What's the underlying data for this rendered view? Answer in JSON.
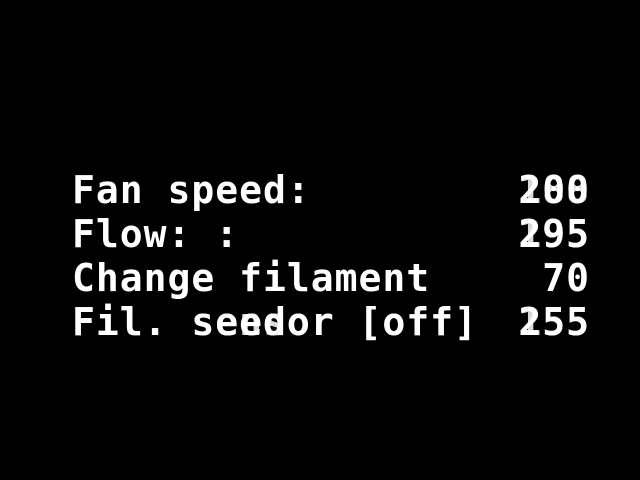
{
  "menu": {
    "rows": [
      {
        "label": "Fan speed:",
        "value": "200",
        "ghost_value": "188"
      },
      {
        "label": "Flow: :",
        "value": "295",
        "ghost_value": "195"
      },
      {
        "label": "Change filament",
        "value": "70"
      },
      {
        "label": "Fil. seedor [off]",
        "value": "255",
        "ghost_label": "Fil. sensor [off]",
        "ghost_value": "155"
      }
    ]
  }
}
